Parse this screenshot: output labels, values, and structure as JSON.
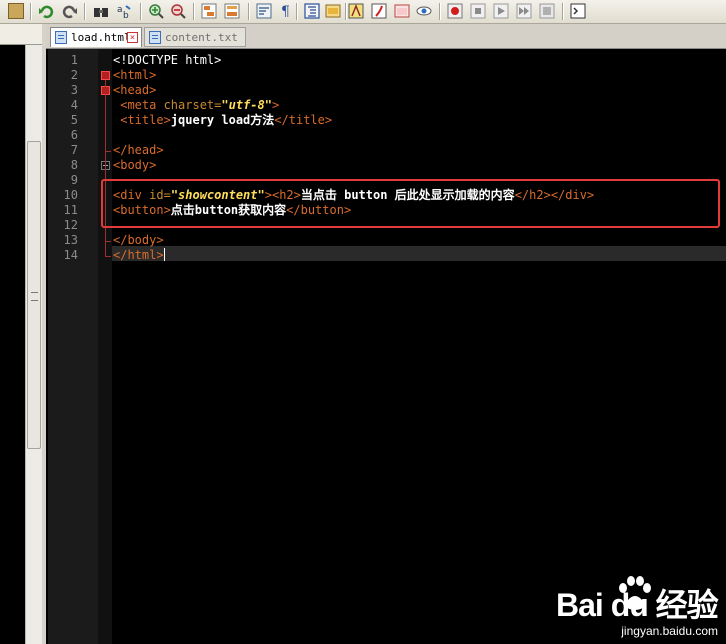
{
  "tabs": [
    {
      "label": "load.html",
      "active": true
    },
    {
      "label": "content.txt",
      "active": false
    }
  ],
  "lines": {
    "numbers": [
      "1",
      "2",
      "3",
      "4",
      "5",
      "6",
      "7",
      "8",
      "9",
      "10",
      "11",
      "12",
      "13",
      "14"
    ],
    "l1": "<!DOCTYPE html>",
    "l2_tag": "<html>",
    "l3_tag": "<head>",
    "l4_open": "<meta",
    "l4_attr": " charset=",
    "l4_val": "\"utf-8\"",
    "l4_close": ">",
    "l5_open": "<title>",
    "l5_text": "jquery load方法",
    "l5_close": "</title>",
    "l7_tag": "</head>",
    "l8_tag": "<body>",
    "l10_open": "<div",
    "l10_attr": " id=",
    "l10_val": "\"showcontent\"",
    "l10_gt": ">",
    "l10_h2open": "<h2>",
    "l10_text": "当点击 button 后此处显示加载的内容",
    "l10_h2close": "</h2>",
    "l10_divclose": "</div>",
    "l11_open": "<button>",
    "l11_text": "点击button获取内容",
    "l11_close": "</button>",
    "l13_tag": "</body>",
    "l14_tag": "</html>"
  },
  "watermark": {
    "logo_text": "Bai du 经验",
    "url": "jingyan.baidu.com"
  },
  "colors": {
    "tag": "#d96c2b",
    "attr_value": "#ffdf5a",
    "highlight_box": "#e23b3b",
    "editor_bg": "#000000"
  }
}
